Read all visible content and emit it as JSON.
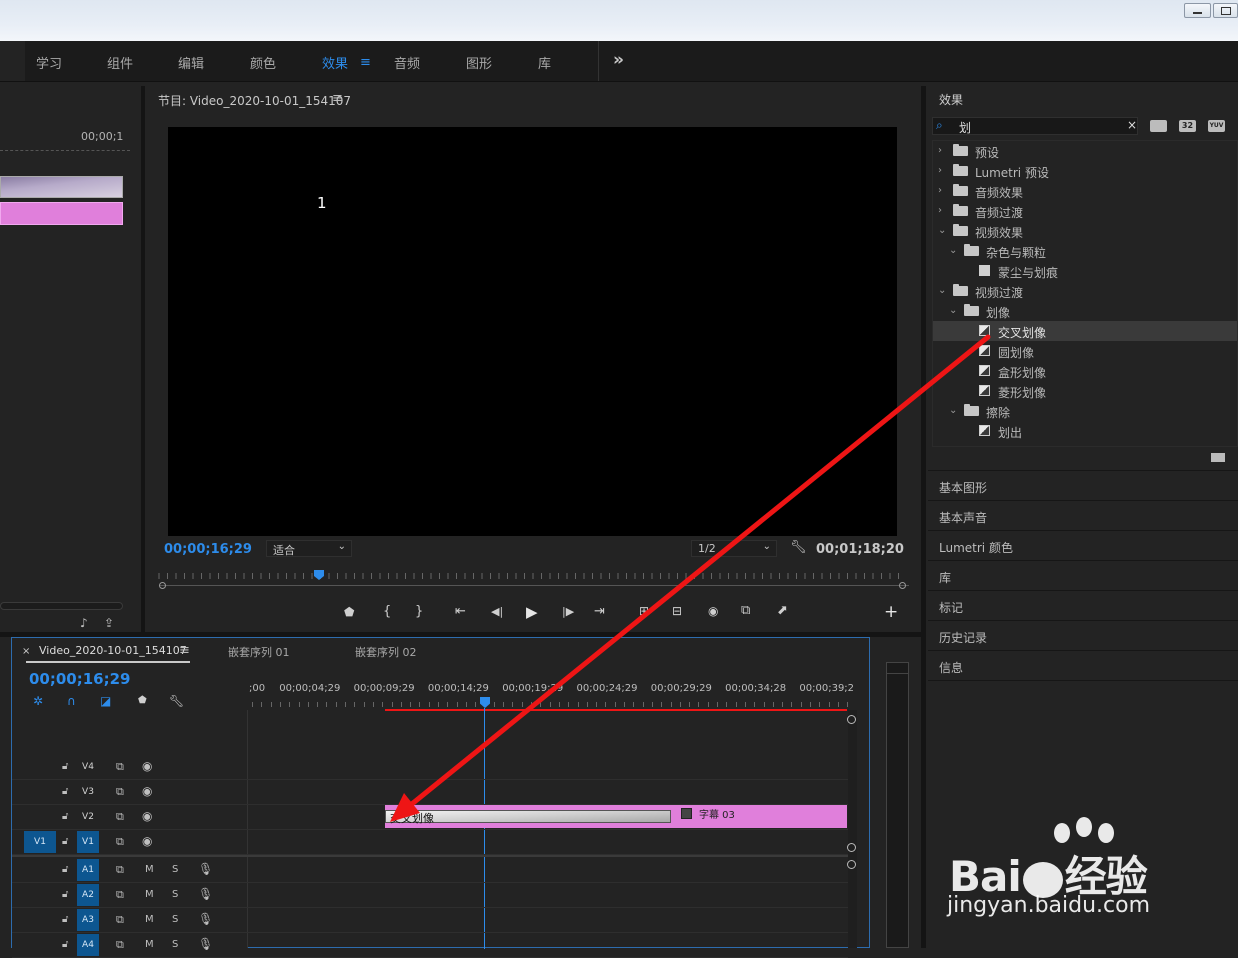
{
  "workspaces": [
    {
      "label": "学习"
    },
    {
      "label": "组件"
    },
    {
      "label": "编辑"
    },
    {
      "label": "颜色"
    },
    {
      "label": "效果"
    },
    {
      "label": "音频"
    },
    {
      "label": "图形"
    },
    {
      "label": "库"
    }
  ],
  "active_workspace": "效果",
  "overflow_label": "»",
  "source_monitor": {
    "timecode": "00;00;1"
  },
  "program_monitor": {
    "title": "节目: Video_2020-10-01_154107",
    "frame_text": "1",
    "current_timecode": "00;00;16;29",
    "fit_option": "适合",
    "resolution": "1/2",
    "duration": "00;01;18;20"
  },
  "effects_panel": {
    "title": "效果",
    "search_value": "划",
    "badges": [
      "32",
      "YUV"
    ],
    "tree": [
      {
        "label": "预设",
        "level": 0,
        "kind": "folder",
        "expanded": false
      },
      {
        "label": "Lumetri 预设",
        "level": 0,
        "kind": "folder",
        "expanded": false
      },
      {
        "label": "音频效果",
        "level": 0,
        "kind": "folder",
        "expanded": false
      },
      {
        "label": "音频过渡",
        "level": 0,
        "kind": "folder",
        "expanded": false
      },
      {
        "label": "视频效果",
        "level": 0,
        "kind": "folder",
        "expanded": true
      },
      {
        "label": "杂色与颗粒",
        "level": 1,
        "kind": "folder",
        "expanded": true
      },
      {
        "label": "蒙尘与划痕",
        "level": 2,
        "kind": "effect"
      },
      {
        "label": "视频过渡",
        "level": 0,
        "kind": "folder",
        "expanded": true
      },
      {
        "label": "划像",
        "level": 1,
        "kind": "folder",
        "expanded": true
      },
      {
        "label": "交叉划像",
        "level": 2,
        "kind": "transition",
        "selected": true
      },
      {
        "label": "圆划像",
        "level": 2,
        "kind": "transition"
      },
      {
        "label": "盒形划像",
        "level": 2,
        "kind": "transition"
      },
      {
        "label": "菱形划像",
        "level": 2,
        "kind": "transition"
      },
      {
        "label": "擦除",
        "level": 1,
        "kind": "folder",
        "expanded": true
      },
      {
        "label": "划出",
        "level": 2,
        "kind": "transition"
      }
    ]
  },
  "side_panels": [
    {
      "label": "基本图形"
    },
    {
      "label": "基本声音"
    },
    {
      "label": "Lumetri 颜色"
    },
    {
      "label": "库"
    },
    {
      "label": "标记"
    },
    {
      "label": "历史记录"
    },
    {
      "label": "信息"
    }
  ],
  "timeline": {
    "tabs": [
      {
        "label": "Video_2020-10-01_154107"
      },
      {
        "label": "嵌套序列 01"
      },
      {
        "label": "嵌套序列 02"
      }
    ],
    "timecode": "00;00;16;29",
    "ruler": [
      ";00",
      "00;00;04;29",
      "00;00;09;29",
      "00;00;14;29",
      "00;00;19;29",
      "00;00;24;29",
      "00;00;29;29",
      "00;00;34;28",
      "00;00;39;2"
    ],
    "video_tracks": [
      "V4",
      "V3",
      "V2",
      "V1"
    ],
    "source_patch": "V1",
    "audio_tracks": [
      "A1",
      "A2",
      "A3",
      "A4"
    ],
    "mute_label": "M",
    "solo_label": "S",
    "transition_label": "交叉划像",
    "clip_label": "字幕 03"
  },
  "colors": {
    "accent": "#2d8ceb",
    "clip": "#e07fdb",
    "arrow": "#ee1515",
    "track_active": "#0d5690"
  },
  "watermark": {
    "logo": "Bai du 经验",
    "url": "jingyan.baidu.com"
  }
}
